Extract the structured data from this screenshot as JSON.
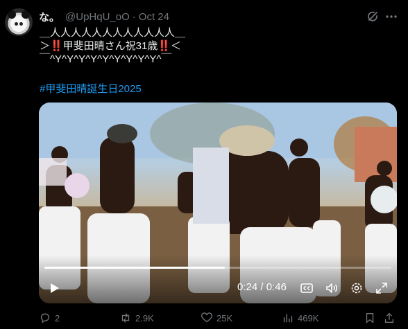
{
  "tweet": {
    "display_name": "な。",
    "handle": "@UpHqU_oO",
    "separator": "·",
    "date": "Oct 24",
    "text_line1": "＿人人人人人人人人人人人人＿",
    "text_line2": "＞‼️甲斐田晴さん祝31歳‼️＜",
    "text_line3": "￣^Y^Y^Y^Y^Y^Y^Y^Y^Y^￣",
    "hashtag": "#甲斐田晴誕生日2025"
  },
  "video": {
    "current_time": "0:24",
    "time_separator": "/",
    "duration": "0:46",
    "progress_fraction": 0.52
  },
  "actions": {
    "replies": "2",
    "reposts": "2.9K",
    "likes": "25K",
    "views": "469K"
  },
  "icons": [
    "grok-icon",
    "more-icon",
    "play-icon",
    "captions-icon",
    "volume-icon",
    "settings-icon",
    "fullscreen-icon",
    "reply-icon",
    "repost-icon",
    "like-icon",
    "views-icon",
    "bookmark-icon",
    "share-icon"
  ],
  "colors": {
    "background": "#000000",
    "text": "#e7e9ea",
    "muted": "#71767b",
    "link": "#1d9bf0"
  }
}
